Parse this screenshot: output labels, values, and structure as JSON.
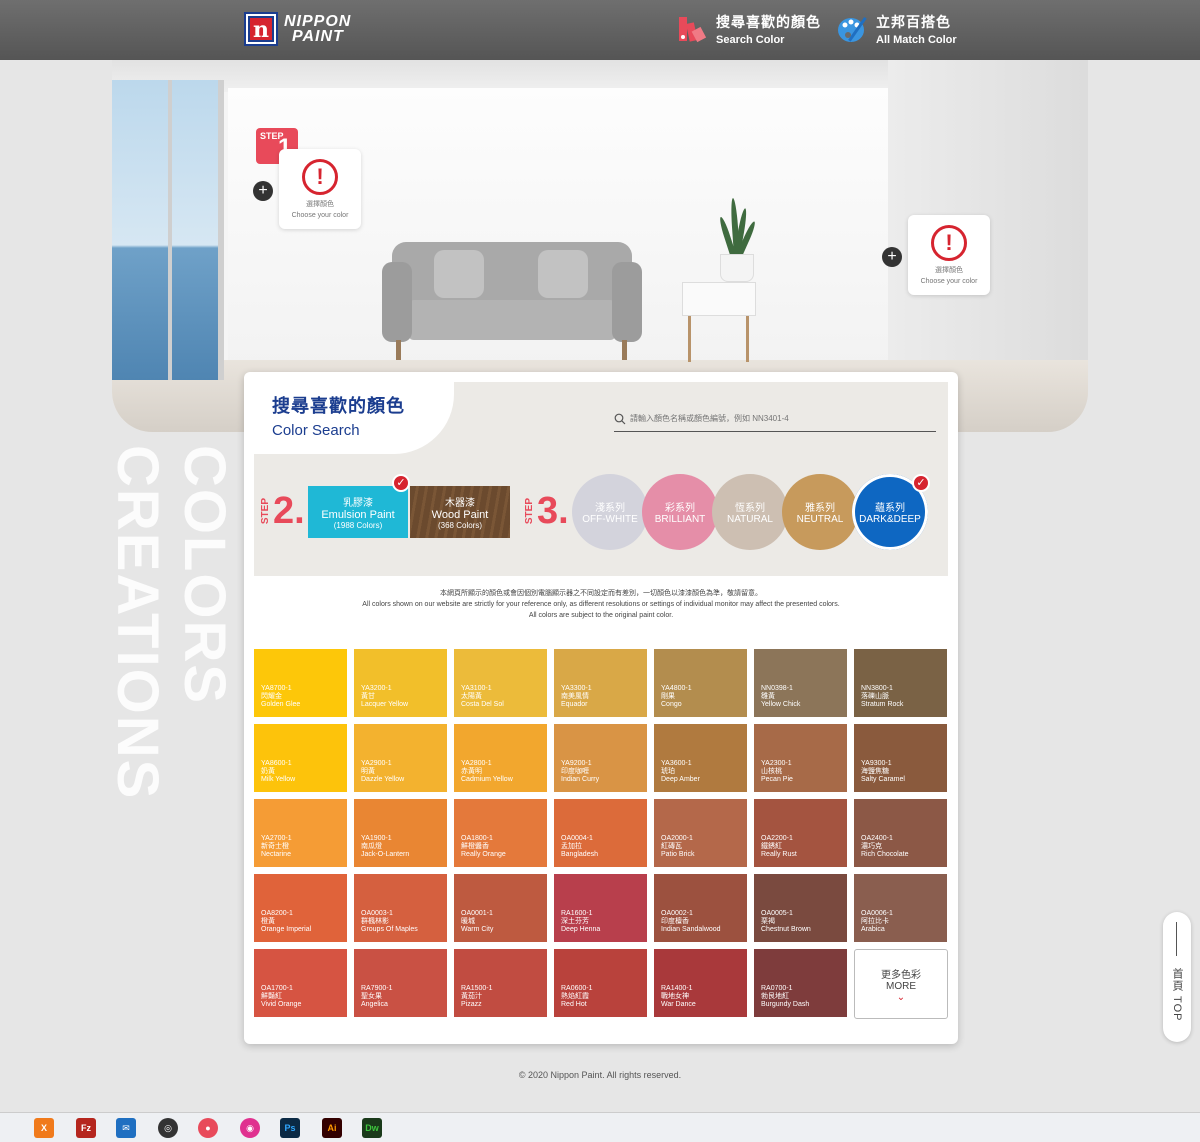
{
  "header": {
    "logo_line1": "NIPPON",
    "logo_line2": "PAINT",
    "logo_mark": "n",
    "nav": [
      {
        "zh": "搜尋喜歡的顏色",
        "en": "Search Color",
        "icon": "palette-swatch-icon"
      },
      {
        "zh": "立邦百搭色",
        "en": "All Match Color",
        "icon": "paint-palette-icon"
      }
    ]
  },
  "room": {
    "step1": {
      "label": "STEP",
      "num": "1."
    },
    "choose_zh": "選擇顏色",
    "choose_en": "Choose your color",
    "plus": "+"
  },
  "side_text": "COLORS CREATIONS",
  "panel": {
    "title_zh": "搜尋喜歡的顏色",
    "title_en": "Color Search",
    "search_placeholder": "請輸入顏色名稱或顏色編號，例如 NN3401-4",
    "step2": {
      "label": "STEP",
      "num": "2."
    },
    "step3": {
      "label": "STEP",
      "num": "3."
    },
    "paint_types": [
      {
        "zh": "乳膠漆",
        "en": "Emulsion Paint",
        "count": "(1988 Colors)",
        "color": "#1fb8d6",
        "selected": true
      },
      {
        "zh": "木器漆",
        "en": "Wood Paint",
        "count": "(368 Colors)",
        "color": "#6b4a2e",
        "selected": false
      }
    ],
    "series": [
      {
        "zh": "淺系列",
        "en": "OFF-WHITE",
        "color": "#d3d3dc",
        "selected": false
      },
      {
        "zh": "彩系列",
        "en": "BRILLIANT",
        "color": "#e58ea8",
        "selected": false
      },
      {
        "zh": "恆系列",
        "en": "NATURAL",
        "color": "#cdbfb2",
        "selected": false
      },
      {
        "zh": "雅系列",
        "en": "NEUTRAL",
        "color": "#c79a5c",
        "selected": false
      },
      {
        "zh": "蘊系列",
        "en": "DARK&DEEP",
        "color": "#0e67c2",
        "selected": true
      }
    ],
    "check_mark": "✓",
    "disclaimer": [
      "本網頁所顯示的顏色或會因個別電腦顯示器之不同設定而有差別，一切顏色以漆漆顏色為準，敬請留意。",
      "All colors shown on our website are strictly for your reference only, as different resolutions or settings of individual monitor may affect the presented colors.",
      "All colors are subject to the original paint color."
    ],
    "swatches": [
      {
        "code": "YA8700-1",
        "zh": "閃耀金",
        "en": "Golden Glee",
        "color": "#fdc709"
      },
      {
        "code": "YA3200-1",
        "zh": "黃甘",
        "en": "Lacquer Yellow",
        "color": "#f2bf2a"
      },
      {
        "code": "YA3100-1",
        "zh": "太陽黃",
        "en": "Costa Del Sol",
        "color": "#ecbb3a"
      },
      {
        "code": "YA3300-1",
        "zh": "南美風情",
        "en": "Equador",
        "color": "#d9a847"
      },
      {
        "code": "YA4800-1",
        "zh": "剛果",
        "en": "Congo",
        "color": "#b38d4e"
      },
      {
        "code": "NN0398-1",
        "zh": "雛黃",
        "en": "Yellow Chick",
        "color": "#8c7559"
      },
      {
        "code": "NN3800-1",
        "zh": "落礫山脈",
        "en": "Stratum Rock",
        "color": "#7a6245"
      },
      {
        "code": "YA8600-1",
        "zh": "奶黃",
        "en": "Milk Yellow",
        "color": "#fdc30b"
      },
      {
        "code": "YA2900-1",
        "zh": "明黃",
        "en": "Dazzle Yellow",
        "color": "#f3b22f"
      },
      {
        "code": "YA2800-1",
        "zh": "赤黃明",
        "en": "Cadmium Yellow",
        "color": "#f2a72e"
      },
      {
        "code": "YA9200-1",
        "zh": "印度咖喱",
        "en": "Indian Curry",
        "color": "#d99445"
      },
      {
        "code": "YA3600-1",
        "zh": "琥珀",
        "en": "Deep Amber",
        "color": "#b07a3f"
      },
      {
        "code": "YA2300-1",
        "zh": "山核桃",
        "en": "Pecan Pie",
        "color": "#a76a48"
      },
      {
        "code": "YA9300-1",
        "zh": "海鹽焦糖",
        "en": "Salty Caramel",
        "color": "#8a5a3d"
      },
      {
        "code": "YA2700-1",
        "zh": "新奇士橙",
        "en": "Nectarine",
        "color": "#f59c35"
      },
      {
        "code": "YA1900-1",
        "zh": "南瓜燈",
        "en": "Jack-O-Lantern",
        "color": "#e98633"
      },
      {
        "code": "OA1800-1",
        "zh": "鮮橙醬香",
        "en": "Really Orange",
        "color": "#e4793b"
      },
      {
        "code": "OA0004-1",
        "zh": "孟加拉",
        "en": "Bangladesh",
        "color": "#dc6b3a"
      },
      {
        "code": "OA2000-1",
        "zh": "紅磚瓦",
        "en": "Patio Brick",
        "color": "#b4684a"
      },
      {
        "code": "OA2200-1",
        "zh": "鐵銹紅",
        "en": "Really Rust",
        "color": "#a45440"
      },
      {
        "code": "OA2400-1",
        "zh": "濃巧克",
        "en": "Rich Chocolate",
        "color": "#8c5846"
      },
      {
        "code": "OA8200-1",
        "zh": "橙黃",
        "en": "Orange Imperial",
        "color": "#e0633a"
      },
      {
        "code": "OA0003-1",
        "zh": "群楓林影",
        "en": "Groups Of Maples",
        "color": "#d5603f"
      },
      {
        "code": "OA0001-1",
        "zh": "暖城",
        "en": "Warm City",
        "color": "#be5a40"
      },
      {
        "code": "RA1600-1",
        "zh": "深土芬芳",
        "en": "Deep Henna",
        "color": "#b83f4c"
      },
      {
        "code": "OA0002-1",
        "zh": "印度檀香",
        "en": "Indian Sandalwood",
        "color": "#9c513f"
      },
      {
        "code": "OA0005-1",
        "zh": "栗褐",
        "en": "Chestnut Brown",
        "color": "#7a4a3f"
      },
      {
        "code": "OA0006-1",
        "zh": "阿拉比卡",
        "en": "Arabica",
        "color": "#8a5e4f"
      },
      {
        "code": "OA1700-1",
        "zh": "鮮豔紅",
        "en": "Vivid Orange",
        "color": "#d65442"
      },
      {
        "code": "RA7900-1",
        "zh": "聖女果",
        "en": "Angelica",
        "color": "#c95144"
      },
      {
        "code": "RA1500-1",
        "zh": "黃茄汁",
        "en": "Pizazz",
        "color": "#c14c41"
      },
      {
        "code": "RA0600-1",
        "zh": "熱焰紅霞",
        "en": "Red Hot",
        "color": "#b9423c"
      },
      {
        "code": "RA1400-1",
        "zh": "戰地女神",
        "en": "War Dance",
        "color": "#a9393b"
      },
      {
        "code": "RA0700-1",
        "zh": "勃艮地紅",
        "en": "Burgundy Dash",
        "color": "#7e3c3c"
      }
    ],
    "more_zh": "更多色彩",
    "more_en": "MORE",
    "more_chev": "⌄"
  },
  "footer": "© 2020 Nippon Paint. All rights reserved.",
  "totop": "首頁 TOP",
  "taskbar": [
    "X",
    "Fz",
    "✉",
    "◎",
    "●",
    "◉",
    "Ps",
    "Ai",
    "Dw"
  ]
}
